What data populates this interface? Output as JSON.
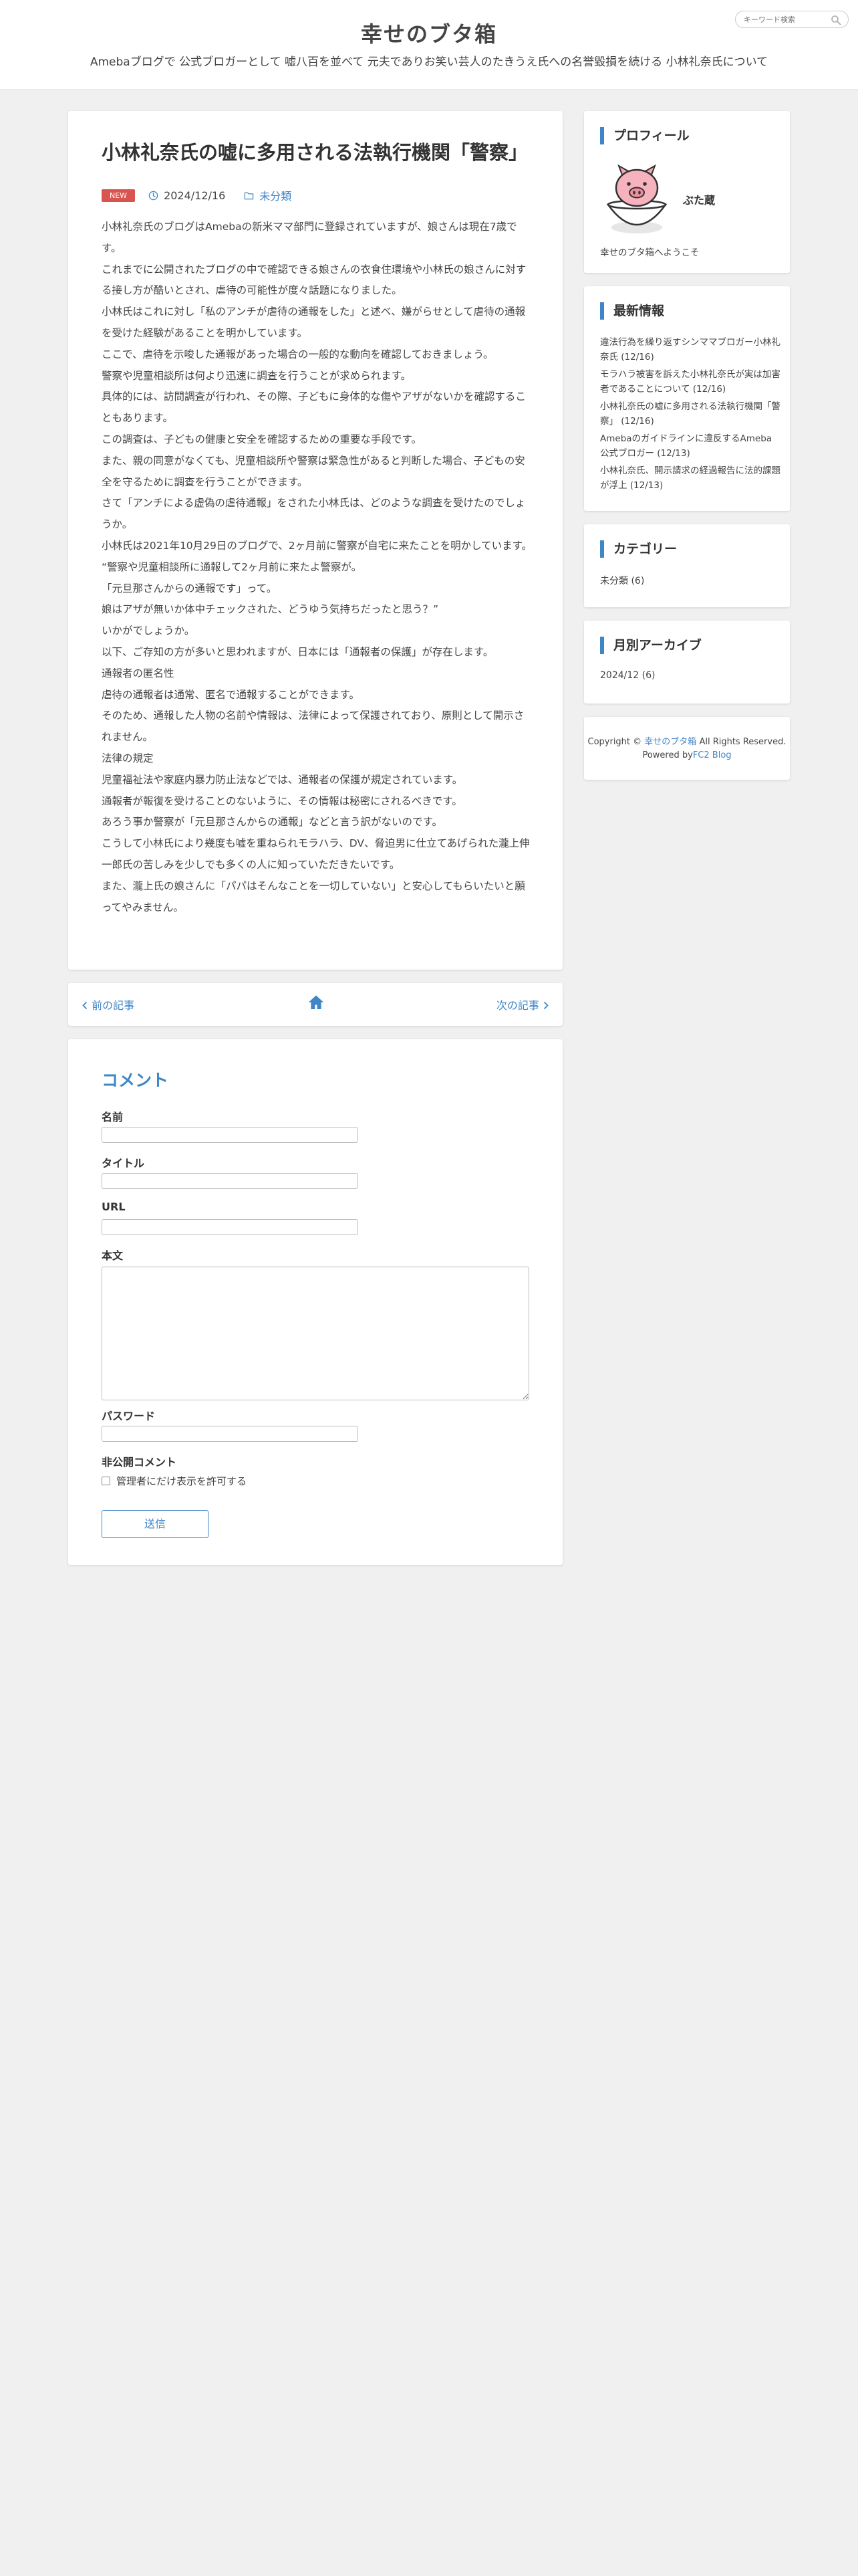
{
  "header": {
    "site_title": "幸せのブタ箱",
    "description": "Amebaブログで 公式ブロガーとして 嘘八百を並べて 元夫でありお笑い芸人のたきうえ氏への名誉毀損を続ける 小林礼奈氏について",
    "search_placeholder": "キーワード検索"
  },
  "article": {
    "title": "小林礼奈氏の嘘に多用される法執行機関「警察」",
    "badge": "NEW",
    "date": "2024/12/16",
    "category": "未分類",
    "paragraphs": [
      "小林礼奈氏のブログはAmebaの新米ママ部門に登録されていますが、娘さんは現在7歳です。",
      "これまでに公開されたブログの中で確認できる娘さんの衣食住環境や小林氏の娘さんに対する接し方が酷いとされ、虐待の可能性が度々話題になりました。",
      "小林氏はこれに対し「私のアンチが虐待の通報をした」と述べ、嫌がらせとして虐待の通報を受けた経験があることを明かしています。",
      "ここで、虐待を示唆した通報があった場合の一般的な動向を確認しておきましょう。",
      "警察や児童相談所は何より迅速に調査を行うことが求められます。",
      "具体的には、訪問調査が行われ、その際、子どもに身体的な傷やアザがないかを確認することもあります。",
      "この調査は、子どもの健康と安全を確認するための重要な手段です。",
      "また、親の同意がなくても、児童相談所や警察は緊急性があると判断した場合、子どもの安全を守るために調査を行うことができます。",
      "さて「アンチによる虚偽の虐待通報」をされた小林氏は、どのような調査を受けたのでしょうか。",
      "小林氏は2021年10月29日のブログで、2ヶ月前に警察が自宅に来たことを明かしています。",
      "“警察や児童相談所に通報して2ヶ月前に来たよ警察が。",
      "「元旦那さんからの通報です」って。",
      "娘はアザが無いか体中チェックされた、どうゆう気持ちだったと思う？”",
      "いかがでしょうか。",
      "以下、ご存知の方が多いと思われますが、日本には「通報者の保護」が存在します。",
      "通報者の匿名性",
      "虐待の通報者は通常、匿名で通報することができます。",
      "そのため、通報した人物の名前や情報は、法律によって保護されており、原則として開示されません。",
      "法律の規定",
      "児童福祉法や家庭内暴力防止法などでは、通報者の保護が規定されています。",
      "通報者が報復を受けることのないように、その情報は秘密にされるべきです。",
      "あろう事か警察が「元旦那さんからの通報」などと言う訳がないのです。",
      "こうして小林氏により幾度も嘘を重ねられモラハラ、DV、脅迫男に仕立てあげられた瀧上伸一郎氏の苦しみを少しでも多くの人に知っていただきたいです。",
      "また、瀧上氏の娘さんに「パパはそんなことを一切していない」と安心してもらいたいと願ってやみません。"
    ]
  },
  "pager": {
    "prev_label": "前の記事",
    "next_label": "次の記事"
  },
  "comment": {
    "title": "コメント",
    "name_label": "名前",
    "title_label": "タイトル",
    "url_label": "URL",
    "body_label": "本文",
    "password_label": "パスワード",
    "private_label": "非公開コメント",
    "checkbox_label": "管理者にだけ表示を許可する",
    "submit_label": "送信"
  },
  "sidebar": {
    "profile": {
      "heading": "プロフィール",
      "name": "ぶた蔵",
      "welcome": "幸せのブタ箱へようこそ"
    },
    "recent": {
      "heading": "最新情報",
      "items": [
        "違法行為を繰り返すシンママブロガー小林礼奈氏 (12/16)",
        "モラハラ被害を訴えた小林礼奈氏が実は加害者であることについて (12/16)",
        "小林礼奈氏の嘘に多用される法執行機関「警察」 (12/16)",
        "Amebaのガイドラインに違反するAmeba公式ブロガー (12/13)",
        "小林礼奈氏、開示請求の経過報告に法的課題が浮上 (12/13)"
      ]
    },
    "category": {
      "heading": "カテゴリー",
      "item": "未分類 (6)"
    },
    "archive": {
      "heading": "月別アーカイブ",
      "item": "2024/12 (6)"
    },
    "copyright": {
      "prefix": "Copyright © ",
      "site": "幸せのブタ箱",
      "suffix": " All Rights Reserved.",
      "powered_prefix": "Powered by",
      "powered_link": "FC2 Blog"
    }
  },
  "colors": {
    "accent": "#3f86c7",
    "badge": "#d9534f",
    "background": "#f0f0f0"
  },
  "icons": [
    "search-icon",
    "clock-icon",
    "folder-icon",
    "chevron-left-icon",
    "home-icon",
    "chevron-right-icon"
  ]
}
